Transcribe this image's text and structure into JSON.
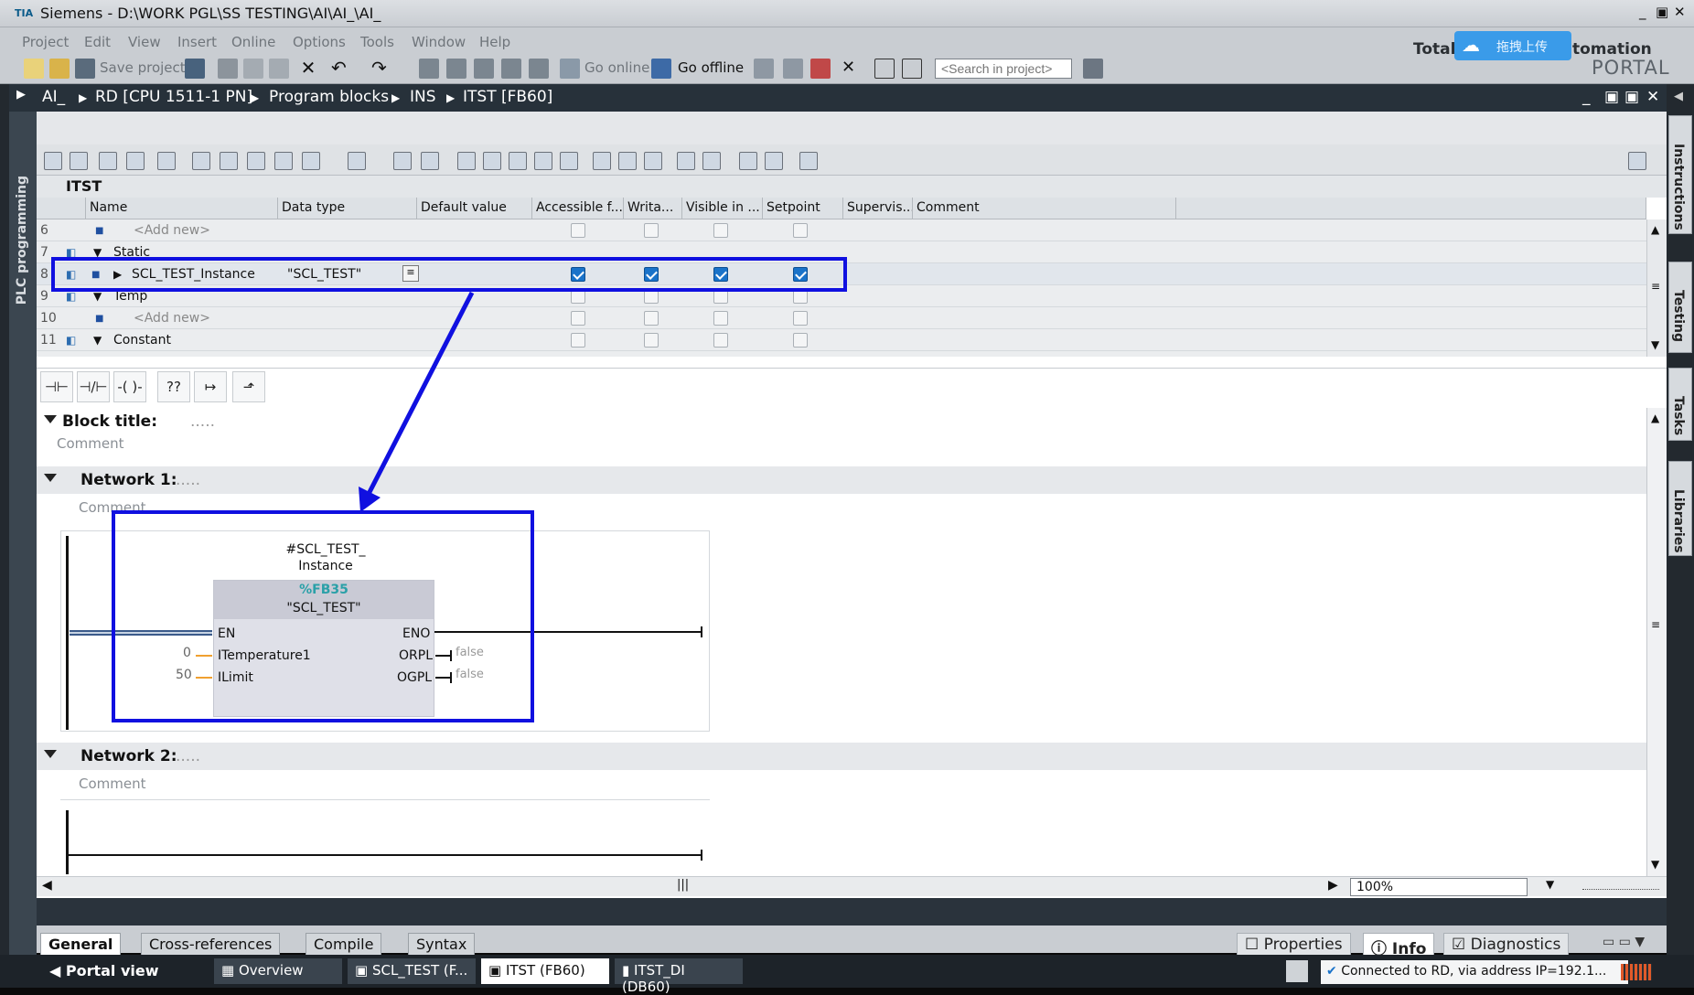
{
  "window": {
    "logo": "TIA",
    "title": "Siemens  -  D:\\WORK PGL\\SS TESTING\\AI\\AI_\\AI_"
  },
  "menu": [
    "Project",
    "Edit",
    "View",
    "Insert",
    "Online",
    "Options",
    "Tools",
    "Window",
    "Help"
  ],
  "toolbar": {
    "save_label": "Save project",
    "go_online": "Go online",
    "go_offline": "Go offline",
    "search_placeholder": "<Search in project>"
  },
  "brand": {
    "total": "Total",
    "automation": "tomation",
    "portal": "PORTAL",
    "cloud_label": "拖拽上传"
  },
  "breadcrumb": [
    "AI_",
    "RD [CPU 1511-1 PN]",
    "Program blocks",
    "INS",
    "ITST [FB60]"
  ],
  "sidebar_tabs": [
    "Instructions",
    "Testing",
    "Tasks",
    "Libraries"
  ],
  "left_bar_label": "PLC programming",
  "block_name": "ITST",
  "table": {
    "headers": [
      "Name",
      "Data type",
      "Default value",
      "Accessible f...",
      "Writa...",
      "Visible in ...",
      "Setpoint",
      "Supervis...",
      "Comment"
    ],
    "rows": [
      {
        "num": "6",
        "name": "<Add new>",
        "type": "",
        "checks": [
          false,
          false,
          false,
          false
        ],
        "kind": "add"
      },
      {
        "num": "7",
        "name": "Static",
        "type": "",
        "checks": [
          false,
          false,
          false,
          false
        ],
        "kind": "section"
      },
      {
        "num": "8",
        "name": "SCL_TEST_Instance",
        "type": "\"SCL_TEST\"",
        "checks": [
          true,
          true,
          true,
          true
        ],
        "kind": "item"
      },
      {
        "num": "9",
        "name": "Temp",
        "type": "",
        "checks": [
          false,
          false,
          false,
          false
        ],
        "kind": "section"
      },
      {
        "num": "10",
        "name": "<Add new>",
        "type": "",
        "checks": [
          false,
          false,
          false,
          false
        ],
        "kind": "add"
      },
      {
        "num": "11",
        "name": "Constant",
        "type": "",
        "checks": [
          false,
          false,
          false,
          false
        ],
        "kind": "section"
      }
    ]
  },
  "block_title": {
    "label": "Block title:",
    "dots": ".....",
    "comment": "Comment"
  },
  "network1": {
    "label": "Network 1:",
    "dots": ".....",
    "comment": "Comment",
    "fb": {
      "instance_line1": "#SCL_TEST_",
      "instance_line2": "Instance",
      "address": "%FB35",
      "type": "\"SCL_TEST\"",
      "inputs": [
        {
          "name": "EN",
          "value": ""
        },
        {
          "name": "ITemperature1",
          "value": "0"
        },
        {
          "name": "ILimit",
          "value": "50"
        }
      ],
      "outputs": [
        {
          "name": "ENO",
          "value": ""
        },
        {
          "name": "ORPL",
          "value": "false"
        },
        {
          "name": "OGPL",
          "value": "false"
        }
      ]
    }
  },
  "network2": {
    "label": "Network 2:",
    "dots": ".....",
    "comment": "Comment"
  },
  "zoom": "100%",
  "bottom_tabs": [
    "General",
    "Cross-references",
    "Compile",
    "Syntax"
  ],
  "inspector_tabs": [
    "Properties",
    "Info",
    "Diagnostics"
  ],
  "taskbar": {
    "portal_view": "Portal view",
    "items": [
      "Overview",
      "SCL_TEST (F...",
      "ITST (FB60)",
      "ITST_DI (DB60)"
    ],
    "status": "Connected to RD, via address IP=192.1..."
  },
  "colors": {
    "highlight_box": "#1010e0",
    "address": "#2aa0a8",
    "selected_check": "#1a73c9"
  }
}
